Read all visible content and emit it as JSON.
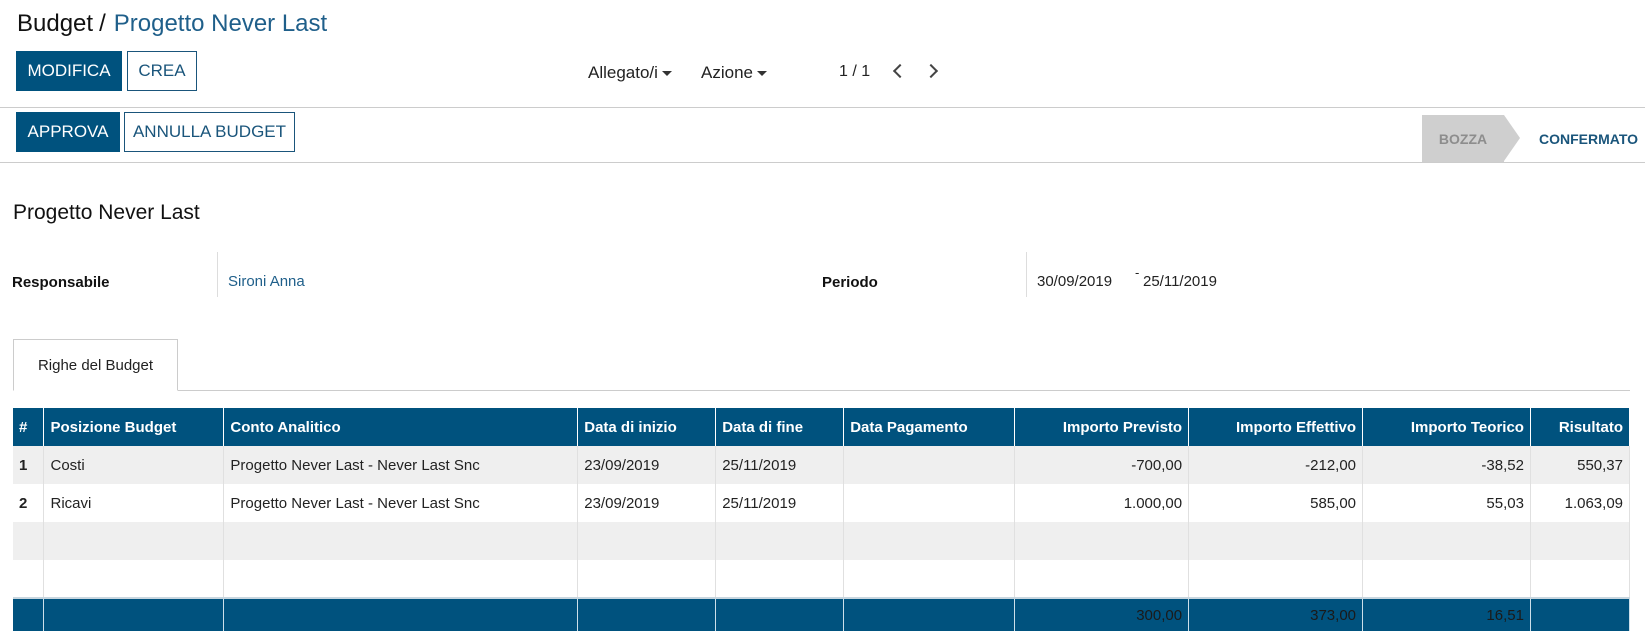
{
  "breadcrumb": {
    "root": "Budget",
    "separator": "/",
    "current": "Progetto Never Last"
  },
  "toolbar": {
    "edit_label": "MODIFICA",
    "create_label": "CREA",
    "attachments_label": "Allegato/i",
    "action_label": "Azione",
    "pager": "1 / 1"
  },
  "statusbar": {
    "approve_label": "APPROVA",
    "cancel_label": "ANNULLA BUDGET",
    "stages": {
      "draft": "BOZZA",
      "confirmed": "CONFERMATO"
    }
  },
  "form": {
    "title": "Progetto Never Last",
    "responsible_label": "Responsabile",
    "responsible_value": "Sironi Anna",
    "period_label": "Periodo",
    "period_start": "30/09/2019",
    "period_dash": "-",
    "period_end": "25/11/2019"
  },
  "tabs": [
    {
      "label": "Righe del Budget"
    }
  ],
  "table": {
    "headers": [
      "#",
      "Posizione Budget",
      "Conto Analitico",
      "Data di inizio",
      "Data di fine",
      "Data Pagamento",
      "Importo Previsto",
      "Importo Effettivo",
      "Importo Teorico",
      "Risultato"
    ],
    "rows": [
      [
        "1",
        "Costi",
        "Progetto Never Last - Never Last Snc",
        "23/09/2019",
        "25/11/2019",
        "",
        "-700,00",
        "-212,00",
        "-38,52",
        "550,37"
      ],
      [
        "2",
        "Ricavi",
        "Progetto Never Last - Never Last Snc",
        "23/09/2019",
        "25/11/2019",
        "",
        "1.000,00",
        "585,00",
        "55,03",
        "1.063,09"
      ]
    ],
    "totals": [
      "",
      "",
      "",
      "",
      "",
      "",
      "300,00",
      "373,00",
      "16,51",
      ""
    ]
  },
  "colors": {
    "primary": "#00527e",
    "link": "#1f5f8a"
  }
}
